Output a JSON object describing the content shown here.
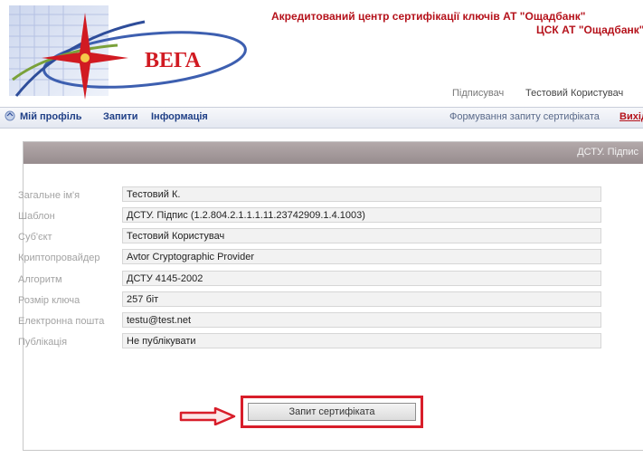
{
  "header": {
    "org_line1": "Акредитований центр сертифікації ключів АТ \"Ощадбанк\"",
    "org_line2": "ЦСК АТ \"Ощадбанк\"",
    "logo_text": "ВЕГА",
    "signer_label": "Підписувач",
    "signer_name": "Тестовий Користувач"
  },
  "nav": {
    "items": [
      {
        "label": "Мій профіль"
      },
      {
        "label": "Запити"
      },
      {
        "label": "Інформація"
      }
    ],
    "cert_request": "Формування запиту сертифіката",
    "logout": "Вихід"
  },
  "panel": {
    "title": "ДСТУ. Підпис"
  },
  "form": {
    "rows": [
      {
        "label": "Загальне ім'я",
        "value": "Тестовий К."
      },
      {
        "label": "Шаблон",
        "value": "ДСТУ. Підпис (1.2.804.2.1.1.1.11.23742909.1.4.1003)"
      },
      {
        "label": "Суб'єкт",
        "value": "Тестовий Користувач"
      },
      {
        "label": "Криптопровайдер",
        "value": "Avtor Cryptographic Provider"
      },
      {
        "label": "Алгоритм",
        "value": "ДСТУ 4145-2002"
      },
      {
        "label": "Розмір ключа",
        "value": "257 біт"
      },
      {
        "label": "Електронна пошта",
        "value": "testu@test.net"
      },
      {
        "label": "Публікація",
        "value": "Не публікувати"
      }
    ],
    "submit_label": "Запит сертифіката"
  },
  "colors": {
    "accent": "#b5121b",
    "nav_link": "#1f3f86",
    "panel_header": "#a89d9f",
    "highlight": "#d81e2a"
  },
  "icons": [
    "vega-logo",
    "nav-icon",
    "arrow-right-icon"
  ]
}
